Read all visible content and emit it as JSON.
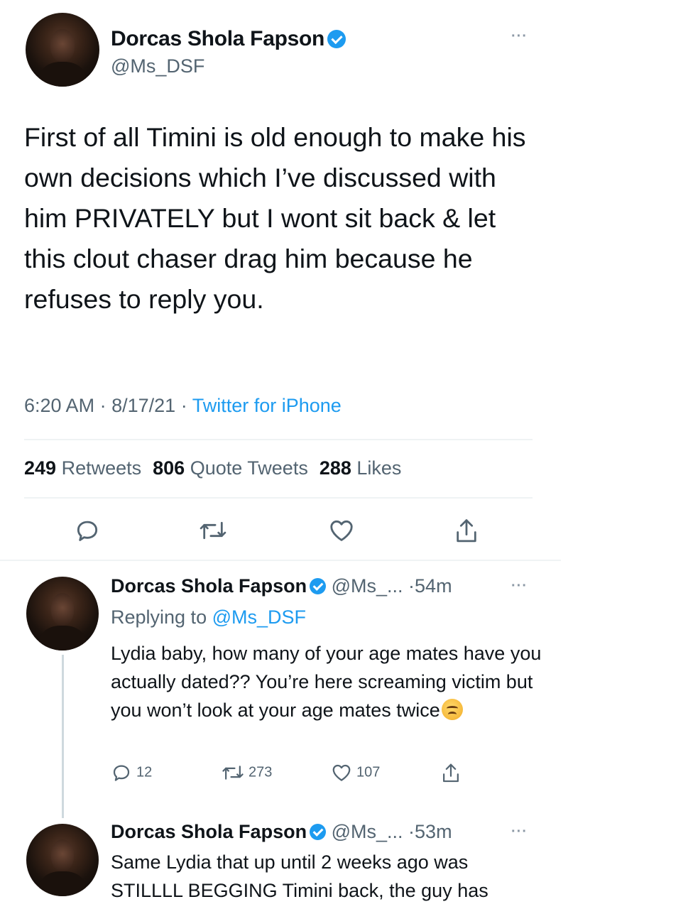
{
  "main_tweet": {
    "author_name": "Dorcas Shola Fapson",
    "author_handle": "@Ms_DSF",
    "more_label": "···",
    "text": "First of all Timini is old enough to make his own decisions which I’ve discussed with him PRIVATELY but I wont sit back & let this clout chaser drag him because he refuses to reply you.",
    "time": "6:20 AM",
    "date": "8/17/21",
    "source": "Twitter for iPhone",
    "retweets_count": "249",
    "retweets_label": "Retweets",
    "quotes_count": "806",
    "quotes_label": "Quote Tweets",
    "likes_count": "288",
    "likes_label": "Likes",
    "actions": [
      "reply-icon",
      "retweet-icon",
      "like-icon",
      "share-icon"
    ]
  },
  "replies": [
    {
      "author_name": "Dorcas Shola Fapson",
      "author_handle": "@Ms_...",
      "age": "54m",
      "more_label": "···",
      "replying_prefix": "Replying to",
      "replying_to": "@Ms_DSF",
      "text": "Lydia baby, how many of your age mates have you actually dated?? You’re here screaming victim but you won’t look at your age mates twice",
      "reply_count": "12",
      "retweet_count": "273",
      "like_count": "107"
    },
    {
      "author_name": "Dorcas Shola Fapson",
      "author_handle": "@Ms_...",
      "age": "53m",
      "more_label": "···",
      "text": "Same Lydia that up until 2 weeks ago was STILLLL BEGGING Timini back, the guy has"
    }
  ],
  "colors": {
    "text": "#0f1419",
    "secondary": "#536471",
    "link": "#1d9bf0",
    "verified": "#1d9bf0",
    "divider": "#eff3f4"
  }
}
